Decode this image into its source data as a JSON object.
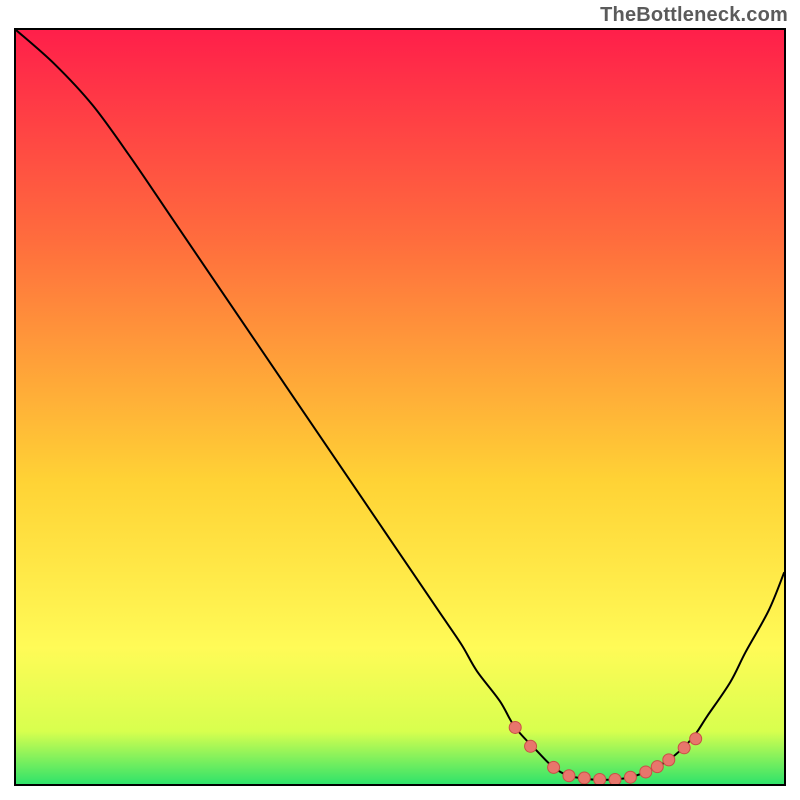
{
  "watermark": "TheBottleneck.com",
  "colors": {
    "grad_top": "#ff1f4a",
    "grad_mid1": "#ff6d3d",
    "grad_mid2": "#ffd335",
    "grad_bottom_yellow": "#fffb57",
    "grad_near_bottom": "#d8ff4e",
    "grad_green": "#30e36a",
    "curve": "#000000",
    "marker_fill": "#e8766c",
    "marker_stroke": "#c94f46"
  },
  "chart_data": {
    "type": "line",
    "title": "",
    "xlabel": "",
    "ylabel": "",
    "xlim": [
      0,
      100
    ],
    "ylim": [
      0,
      100
    ],
    "series": [
      {
        "name": "bottleneck-curve",
        "x": [
          0,
          5,
          10,
          15,
          20,
          25,
          30,
          35,
          40,
          45,
          50,
          55,
          58,
          60,
          63,
          65,
          68,
          70,
          72,
          75,
          78,
          80,
          82,
          85,
          88,
          90,
          93,
          95,
          98,
          100
        ],
        "y": [
          100,
          95.5,
          90,
          83,
          75.5,
          68,
          60.5,
          53,
          45.5,
          38,
          30.5,
          23,
          18.5,
          15,
          11,
          7.5,
          4.2,
          2.2,
          1.1,
          0.6,
          0.6,
          0.9,
          1.6,
          3.2,
          6.0,
          9.0,
          13.5,
          17.5,
          23,
          28
        ]
      }
    ],
    "markers": {
      "name": "highlight-dots",
      "x": [
        65,
        67,
        70,
        72,
        74,
        76,
        78,
        80,
        82,
        83.5,
        85,
        87,
        88.5
      ],
      "y": [
        7.5,
        5.0,
        2.2,
        1.1,
        0.8,
        0.6,
        0.6,
        0.9,
        1.6,
        2.3,
        3.2,
        4.8,
        6.0
      ]
    }
  }
}
